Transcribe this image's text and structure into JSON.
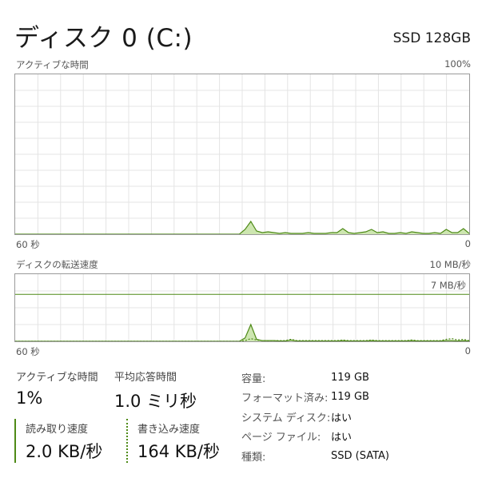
{
  "header": {
    "title": "ディスク 0 (C:)",
    "model": "SSD 128GB"
  },
  "active_chart": {
    "label": "アクティブな時間",
    "max_label": "100%",
    "time_left": "60 秒",
    "time_right": "0",
    "line_color": "#4e8a17",
    "fill_color": "#cde6b0",
    "values": [
      0,
      0,
      0,
      0,
      0,
      0,
      0,
      0,
      0,
      0,
      0,
      0,
      0,
      0,
      0,
      0,
      0,
      0,
      0,
      0,
      0,
      0,
      0,
      0,
      0,
      0,
      0,
      0,
      0,
      0,
      0,
      0,
      0,
      0,
      0,
      0,
      0,
      0,
      0,
      0,
      3,
      8,
      2,
      1,
      1.5,
      1,
      0.5,
      1,
      0.5,
      0.5,
      0.5,
      1,
      0.5,
      0.5,
      0.5,
      1,
      1,
      3.5,
      1,
      0.5,
      1,
      1.5,
      3,
      1,
      1.5,
      0.5,
      0.5,
      1,
      0.5,
      1.5,
      1,
      0.5,
      0.5,
      1,
      0.5,
      3,
      1,
      1,
      3.5,
      0.5
    ]
  },
  "transfer_chart": {
    "label": "ディスクの転送速度",
    "max_label": "10 MB/秒",
    "ref_label": "7 MB/秒",
    "ref_fraction": 0.7,
    "time_left": "60 秒",
    "time_right": "0",
    "line_color": "#4e8a17",
    "fill_color": "#cde6b0",
    "read_values": [
      0,
      0,
      0,
      0,
      0,
      0,
      0,
      0,
      0,
      0,
      0,
      0,
      0,
      0,
      0,
      0,
      0,
      0,
      0,
      0,
      0,
      0,
      0,
      0,
      0,
      0,
      0,
      0,
      0,
      0,
      0,
      0,
      0,
      0,
      0,
      0,
      0,
      0,
      0,
      0,
      0.5,
      2.5,
      0.3,
      0.1,
      0.1,
      0.1,
      0.05,
      0.05,
      0.2,
      0.05,
      0.05,
      0.05,
      0.05,
      0.05,
      0.05,
      0.05,
      0.05,
      0.1,
      0.05,
      0.05,
      0.05,
      0.05,
      0.1,
      0.05,
      0.05,
      0.05,
      0.05,
      0.05,
      0.05,
      0.1,
      0.05,
      0.05,
      0.05,
      0.05,
      0.05,
      0.1,
      0.1,
      0.05,
      0.1,
      0.05
    ],
    "write_values": [
      0,
      0,
      0,
      0,
      0,
      0,
      0,
      0,
      0,
      0,
      0,
      0,
      0,
      0,
      0,
      0,
      0,
      0,
      0,
      0,
      0,
      0,
      0,
      0,
      0,
      0,
      0,
      0,
      0,
      0,
      0,
      0,
      0,
      0,
      0,
      0,
      0,
      0,
      0,
      0,
      0.1,
      0.4,
      0.2,
      0.1,
      0.1,
      0.1,
      0.1,
      0.1,
      0.3,
      0.1,
      0.1,
      0.1,
      0.1,
      0.1,
      0.1,
      0.1,
      0.1,
      0.2,
      0.1,
      0.1,
      0.1,
      0.1,
      0.2,
      0.1,
      0.1,
      0.1,
      0.1,
      0.1,
      0.1,
      0.2,
      0.1,
      0.1,
      0.1,
      0.1,
      0.1,
      0.3,
      0.4,
      0.2,
      0.3,
      0.1
    ]
  },
  "stats": {
    "active_time_label": "アクティブな時間",
    "active_time_value": "1%",
    "response_label": "平均応答時間",
    "response_value": "1.0 ミリ秒",
    "read_label": "読み取り速度",
    "read_value": "2.0 KB/秒",
    "write_label": "書き込み速度",
    "write_value": "164 KB/秒"
  },
  "properties": [
    {
      "key": "容量:",
      "value": "119 GB"
    },
    {
      "key": "フォーマット済み:",
      "value": "119 GB"
    },
    {
      "key": "システム ディスク:",
      "value": "はい"
    },
    {
      "key": "ページ ファイル:",
      "value": "はい"
    },
    {
      "key": "種類:",
      "value": "SSD (SATA)"
    }
  ]
}
